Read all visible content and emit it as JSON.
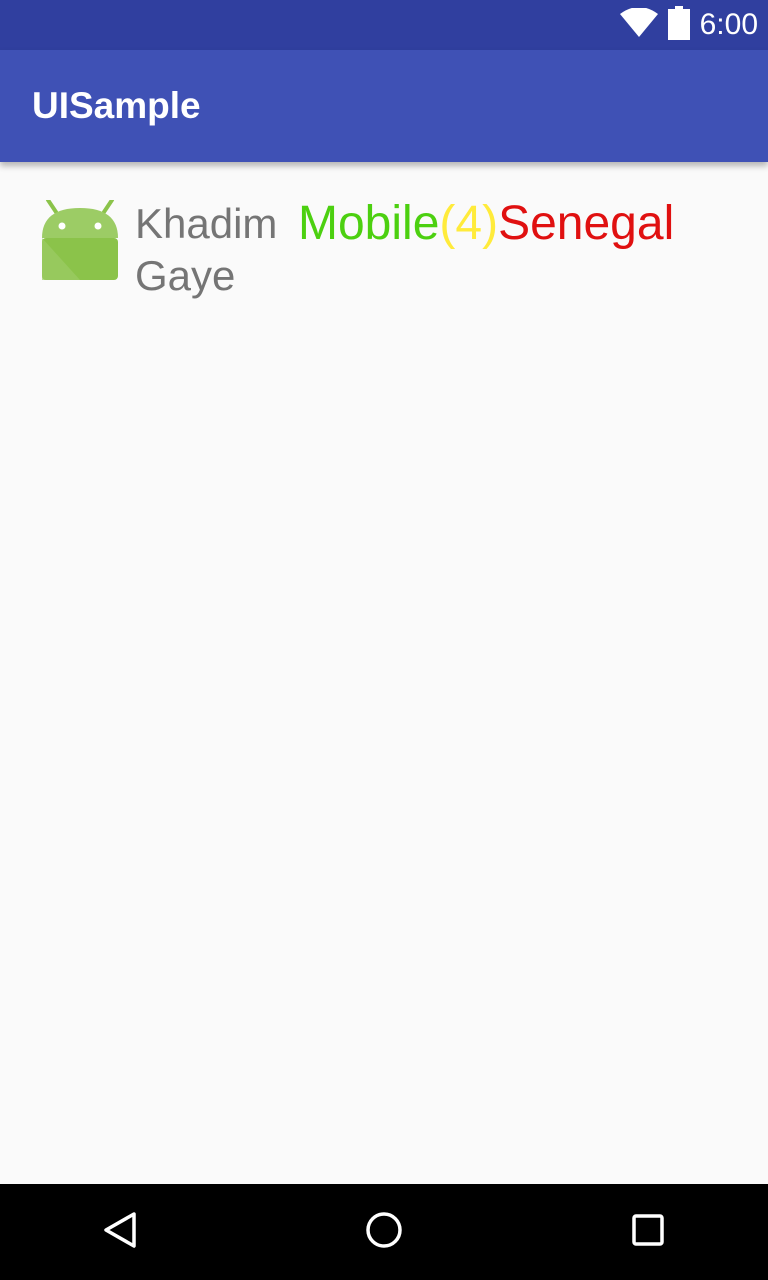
{
  "status_bar": {
    "time": "6:00",
    "icons": [
      "wifi-icon",
      "battery-icon"
    ]
  },
  "app_bar": {
    "title": "UISample"
  },
  "list": {
    "items": [
      {
        "icon": "android-icon",
        "name": "Khadim Gaye",
        "role": "Mobile",
        "count": "(4)",
        "country": "Senegal"
      }
    ]
  },
  "colors": {
    "status_bar": "#303f9f",
    "app_bar": "#3f51b5",
    "role": "#4cd010",
    "count": "#ffeb3b",
    "country": "#e01010",
    "name": "#757575"
  },
  "nav_bar": {
    "buttons": [
      "back-icon",
      "home-icon",
      "recents-icon"
    ]
  }
}
